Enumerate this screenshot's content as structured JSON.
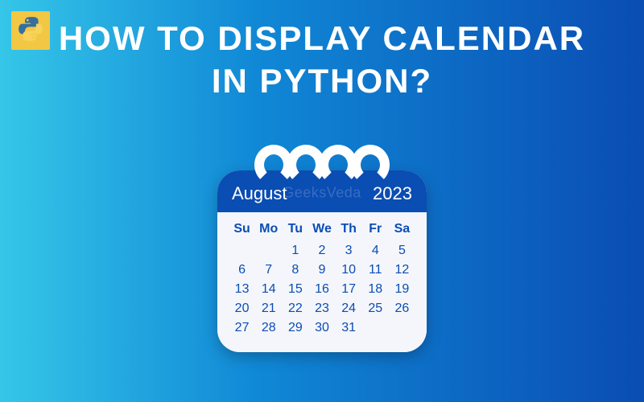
{
  "logo": {
    "name": "python-logo"
  },
  "title_line1": "How to Display Calendar",
  "title_line2": "in Python?",
  "watermark": "GeeksVeda",
  "calendar": {
    "month": "August",
    "year": "2023",
    "weekdays": [
      "Su",
      "Mo",
      "Tu",
      "We",
      "Th",
      "Fr",
      "Sa"
    ],
    "weeks": [
      [
        "",
        "",
        "1",
        "2",
        "3",
        "4",
        "5"
      ],
      [
        "6",
        "7",
        "8",
        "9",
        "10",
        "11",
        "12"
      ],
      [
        "13",
        "14",
        "15",
        "16",
        "17",
        "18",
        "19"
      ],
      [
        "20",
        "21",
        "22",
        "23",
        "24",
        "25",
        "26"
      ],
      [
        "27",
        "28",
        "29",
        "30",
        "31",
        "",
        ""
      ]
    ]
  }
}
